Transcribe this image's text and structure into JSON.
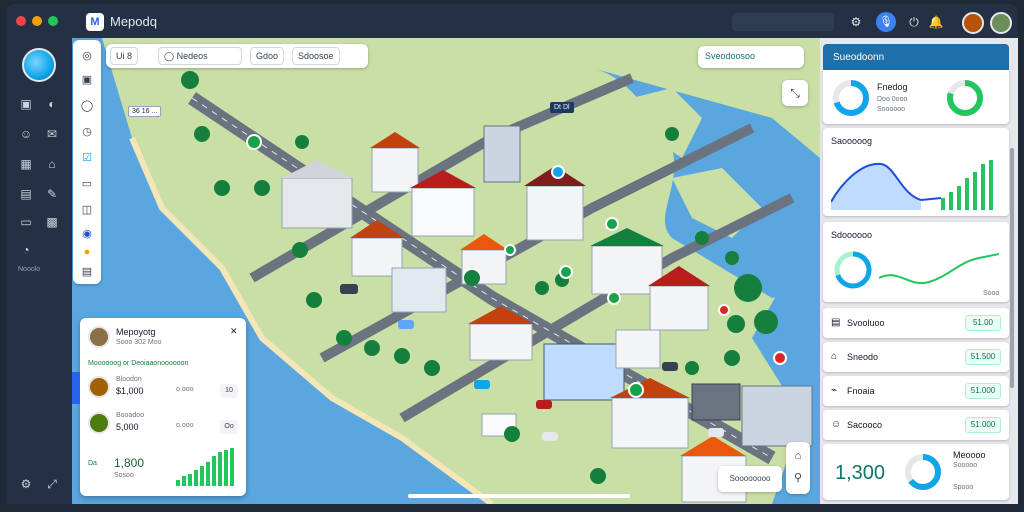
{
  "window": {
    "title": "Mepodq",
    "logo_text": "M",
    "controls": {
      "close_color": "#ef4444",
      "min_color": "#f59e0b",
      "max_color": "#22c55e"
    }
  },
  "topbar": {
    "icons": [
      "activity-icon",
      "mic-icon",
      "power-icon",
      "notification-icon",
      "user-avatar",
      "user-avatar-2"
    ],
    "mic_glyph": "🎙",
    "power_glyph": "⏻",
    "notif_glyph": "🔔",
    "activity_glyph": "⚙"
  },
  "rail": {
    "items": [
      {
        "icon": "camera-icon",
        "glyph": "▣"
      },
      {
        "icon": "headset-icon",
        "glyph": "◐"
      },
      {
        "icon": "users-icon",
        "glyph": "☺"
      },
      {
        "icon": "chat-icon",
        "glyph": "✉"
      },
      {
        "icon": "gallery-icon",
        "glyph": "▦"
      },
      {
        "icon": "tag-icon",
        "glyph": "⌂"
      },
      {
        "icon": "document-icon",
        "glyph": "▤"
      },
      {
        "icon": "edit-icon",
        "glyph": "✎"
      },
      {
        "icon": "folder-icon",
        "glyph": "▭"
      },
      {
        "icon": "grid-icon",
        "glyph": "▩"
      },
      {
        "icon": "chart-icon",
        "glyph": "◔"
      },
      {
        "icon": "settings-icon",
        "glyph": "⚙"
      },
      {
        "icon": "expand-icon",
        "glyph": "⤢"
      }
    ],
    "label": "Nooolo"
  },
  "toolbar": {
    "glyphs": [
      "◎",
      "▣",
      "◯",
      "◷",
      "☑",
      "▭",
      "◫",
      "◉",
      "●",
      "▤"
    ]
  },
  "filters": {
    "chip1": "Ui 8",
    "chip2": "◯ Nedeos",
    "chip3": "Gdoo",
    "chip4": "Sdoosoe"
  },
  "map_pill": {
    "label": "Sveodoosoo"
  },
  "map_ctrl": {
    "glyph": "⤡"
  },
  "map_tags": {
    "tag1": "36 16 ...",
    "tag2": "Dt   Dl"
  },
  "people_card": {
    "title": "Mepoyotg",
    "subtitle": "Sooo 302 Moo",
    "link": "Moooooog or Deoiaaonoooooon",
    "close": "✕",
    "rows": [
      {
        "label": "Bloodon",
        "value": "$1,000",
        "amount": "o.ooo",
        "btn": "10"
      },
      {
        "label": "Booadoo",
        "value": "5,000",
        "amount": "o.ooo",
        "btn": "Oo"
      }
    ],
    "total_label": "Da",
    "total_value": "1,800",
    "total_caption": "Sosoo"
  },
  "bottom": {
    "mini": "Soooooooo",
    "nav_glyphs": [
      "⌂",
      "⚲"
    ]
  },
  "right_panel": {
    "header": "Sueodoonn",
    "card1": {
      "title": "Fnedog",
      "sub1": "Doo 0ooo",
      "sub2": "Soooooo",
      "donut_pct": 70,
      "donut2_pct": 80
    },
    "card2": {
      "title": "Saooooog"
    },
    "card3": {
      "title": "Sdoooooo",
      "caption": "Sooo"
    },
    "rows": [
      {
        "icon": "document-icon",
        "glyph": "▤",
        "label": "Svooluoo",
        "badge": "51.00"
      },
      {
        "icon": "bookmark-icon",
        "glyph": "⌂",
        "label": "Sneodo",
        "badge": "51.500"
      },
      {
        "icon": "link-icon",
        "glyph": "⌁",
        "label": "Fnoaia",
        "badge": "51.000"
      },
      {
        "icon": "users-icon",
        "glyph": "☺",
        "label": "Sacooco",
        "badge": "51.000"
      }
    ],
    "summary": {
      "title": "Meoooo",
      "sub": "Sooooo",
      "value": "1,300",
      "caption": "Spooo",
      "donut_pct": 65
    }
  },
  "colors": {
    "accent": "#1f6fa8",
    "green": "#16a34a",
    "teal": "#0f766e",
    "water": "#5aa7e0",
    "land": "#c9dfa6"
  }
}
